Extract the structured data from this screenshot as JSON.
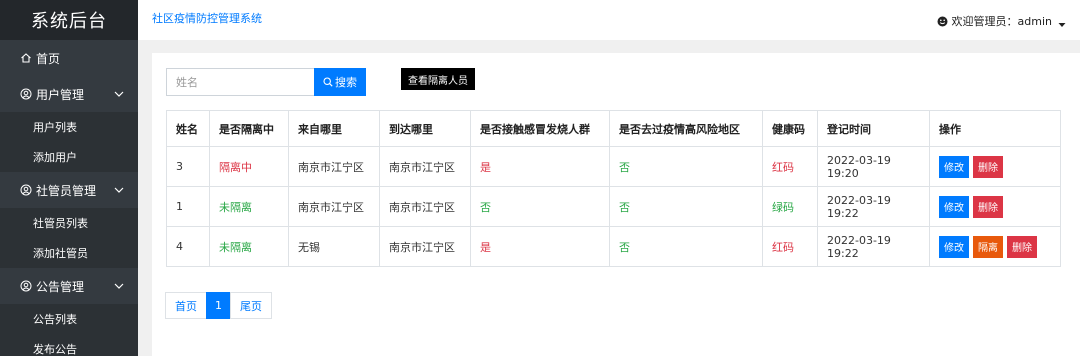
{
  "sidebar": {
    "brand": "系统后台",
    "home": "首页",
    "groups": [
      {
        "label": "用户管理",
        "items": [
          "用户列表",
          "添加用户"
        ]
      },
      {
        "label": "社管员管理",
        "items": [
          "社管员列表",
          "添加社管员"
        ]
      },
      {
        "label": "公告管理",
        "items": [
          "公告列表",
          "发布公告"
        ]
      }
    ]
  },
  "topbar": {
    "app_title": "社区疫情防控管理系统",
    "user_label": "欢迎管理员：admin"
  },
  "search": {
    "placeholder": "姓名",
    "button": "搜索"
  },
  "quarantine_button": "查看隔离人员",
  "table": {
    "headers": [
      "姓名",
      "是否隔离中",
      "来自哪里",
      "到达哪里",
      "是否接触感冒发烧人群",
      "是否去过疫情高风险地区",
      "健康码",
      "登记时间",
      "操作"
    ],
    "rows": [
      {
        "name": "3",
        "isolated": "隔离中",
        "from": "南京市江宁区",
        "to": "南京市江宁区",
        "contact": "是",
        "risk_area": "否",
        "health_code": "红码",
        "time": "2022-03-19 19:20"
      },
      {
        "name": "1",
        "isolated": "未隔离",
        "from": "南京市江宁区",
        "to": "南京市江宁区",
        "contact": "否",
        "risk_area": "否",
        "health_code": "绿码",
        "time": "2022-03-19 19:22"
      },
      {
        "name": "4",
        "isolated": "未隔离",
        "from": "无锡",
        "to": "南京市江宁区",
        "contact": "是",
        "risk_area": "否",
        "health_code": "红码",
        "time": "2022-03-19 19:22"
      }
    ],
    "actions": {
      "edit": "修改",
      "delete": "删除",
      "isolate": "隔离"
    }
  },
  "pager": {
    "first": "首页",
    "current": "1",
    "last": "尾页"
  },
  "colors": {
    "accent": "#007bff",
    "danger": "#dc3545",
    "success": "#28a745",
    "warning": "#e8590c",
    "sidebar": "#343a40"
  }
}
